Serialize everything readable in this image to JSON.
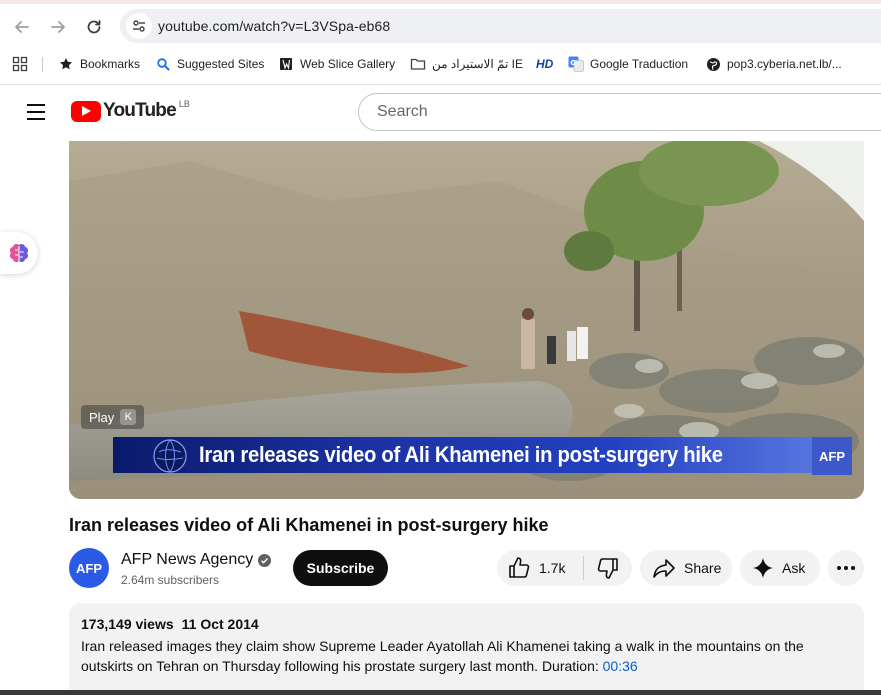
{
  "browser": {
    "url": "youtube.com/watch?v=L3VSpa-eb68",
    "bookmarks": [
      {
        "label": "Bookmarks",
        "icon": "star-icon"
      },
      {
        "label": "Suggested Sites",
        "icon": "search-icon"
      },
      {
        "label": "Web Slice Gallery",
        "icon": "web-slice-icon"
      },
      {
        "label": "تمّ الاستيراد من IE",
        "icon": "folder-icon"
      },
      {
        "label": "HD",
        "icon": "hd-icon"
      },
      {
        "label": "Google Traduction",
        "icon": "google-translate-icon"
      },
      {
        "label": "pop3.cyberia.net.lb/...",
        "icon": "globe-icon"
      }
    ]
  },
  "youtube": {
    "logo_text": "YouTube",
    "region": "LB",
    "search_placeholder": "Search"
  },
  "player": {
    "play_label": "Play",
    "play_key": "K",
    "caption": "Iran releases video of Ali Khamenei in post-surgery hike",
    "watermark": "AFP"
  },
  "video": {
    "title": "Iran releases video of Ali Khamenei in post-surgery hike",
    "channel": {
      "avatar_text": "AFP",
      "name": "AFP News Agency",
      "subscribers": "2.64m subscribers"
    },
    "subscribe_label": "Subscribe",
    "likes": "1.7k",
    "share_label": "Share",
    "ask_label": "Ask",
    "description": {
      "views": "173,149 views",
      "date": "11 Oct 2014",
      "text": "Iran released images they claim show Supreme Leader Ayatollah Ali Khamenei taking a walk in the mountains on the outskirts on Tehran on Thursday following his prostate surgery last month. Duration: ",
      "duration_link": "00:36"
    }
  },
  "colors": {
    "brand_red": "#ff0000",
    "link_blue": "#065fd4",
    "caption_blue": "#2240c0"
  }
}
